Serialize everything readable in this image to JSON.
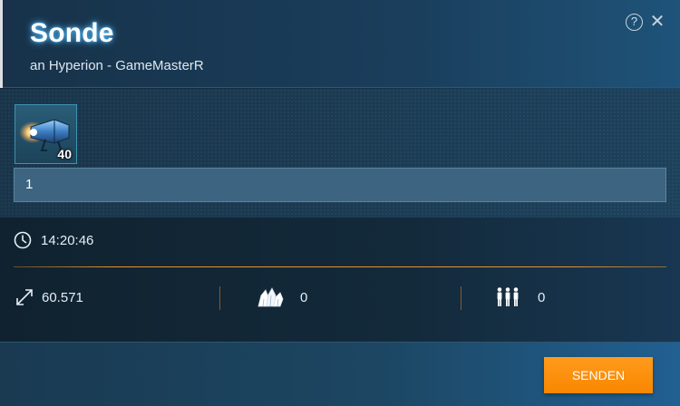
{
  "header": {
    "title": "Sonde",
    "subtitle": "an Hyperion - GameMasterR",
    "help_label": "?",
    "close_label": "✕"
  },
  "selection": {
    "ship": {
      "icon": "probe-icon",
      "count": "40"
    },
    "quantity_value": "1"
  },
  "info": {
    "arrival_time": "14:20:46",
    "distance": "60.571",
    "resources": "0",
    "crew": "0"
  },
  "footer": {
    "send_label": "SENDEN"
  },
  "colors": {
    "accent_orange": "#f98700",
    "title_glow": "#5fc2ff",
    "input_bg": "#3d6480",
    "divider_orange": "#e8912e"
  }
}
